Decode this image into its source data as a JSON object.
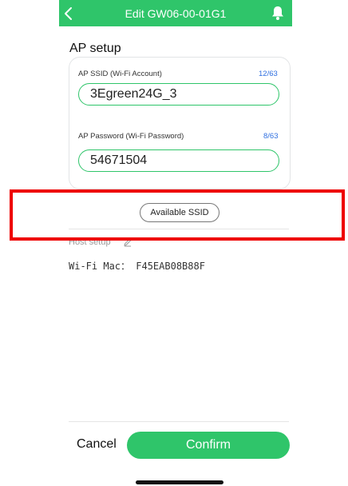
{
  "header": {
    "title": "Edit GW06-00-01G1",
    "back_icon": "chevron-left-icon",
    "bell_icon": "bell-icon",
    "bg_color": "#2fc56a"
  },
  "ap_setup": {
    "section_title": "AP setup",
    "ssid": {
      "label": "AP SSID (Wi-Fi Account)",
      "count": "12/63",
      "value": "3Egreen24G_3"
    },
    "password": {
      "label": "AP Password (Wi-Fi Password)",
      "count": "8/63",
      "value": "54671504"
    },
    "available_ssid_label": "Available SSID"
  },
  "host_setup": {
    "label": "Host setup",
    "edit_icon": "pencil-icon"
  },
  "wifi_mac": "Wi-Fi Mac： F45EAB08B88F",
  "footer": {
    "cancel_label": "Cancel",
    "confirm_label": "Confirm"
  },
  "colors": {
    "accent": "#2fc56a",
    "count": "#2f6fe0",
    "highlight": "#ee0000"
  }
}
